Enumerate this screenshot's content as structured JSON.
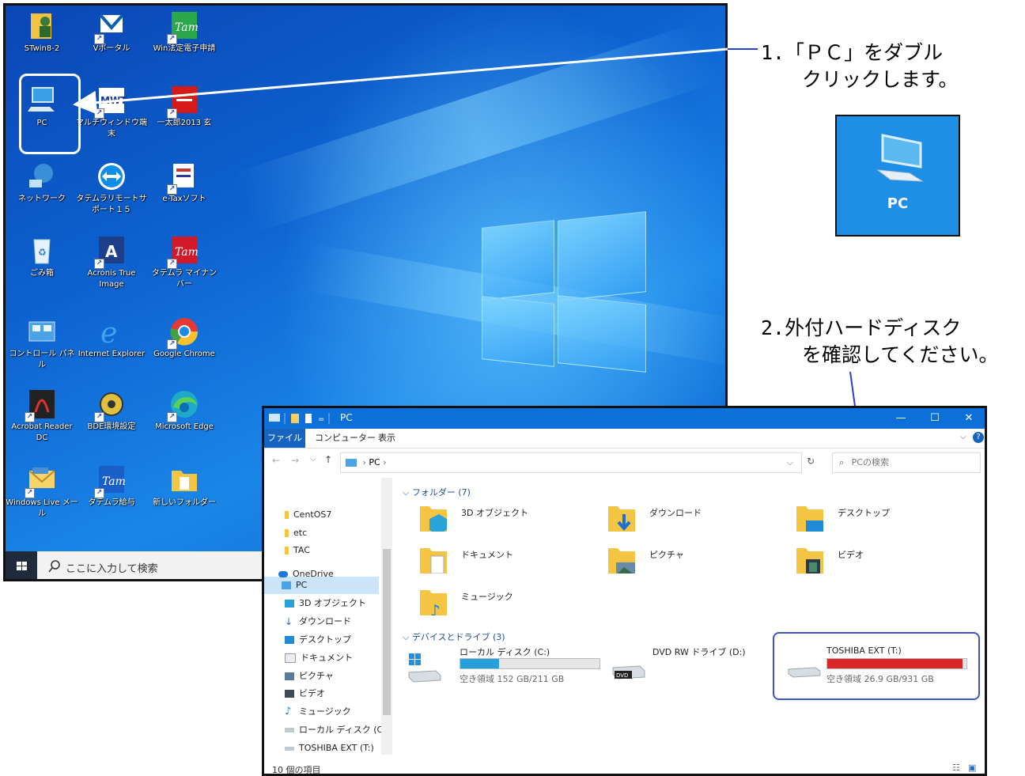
{
  "desktop": {
    "icons": [
      {
        "id": "stwin",
        "label": "STwin8-2"
      },
      {
        "id": "vportal",
        "label": "Vポータル"
      },
      {
        "id": "win-houtei",
        "label": "Win法定電子申請"
      },
      {
        "id": "pc",
        "label": "PC"
      },
      {
        "id": "multiwindow",
        "label": "マルチウィンドウ端末"
      },
      {
        "id": "ichitaro",
        "label": "一太郎2013 玄"
      },
      {
        "id": "network",
        "label": "ネットワーク"
      },
      {
        "id": "remote-support",
        "label": "タテムラリモートサポート１５"
      },
      {
        "id": "etax",
        "label": "e-Taxソフト"
      },
      {
        "id": "recycle",
        "label": "ごみ箱"
      },
      {
        "id": "acronis",
        "label": "Acronis True Image"
      },
      {
        "id": "tatemura-mynumber",
        "label": "タテムラ マイナンバー"
      },
      {
        "id": "control-panel",
        "label": "コントロール パネル"
      },
      {
        "id": "ie",
        "label": "Internet Explorer"
      },
      {
        "id": "chrome",
        "label": "Google Chrome"
      },
      {
        "id": "acrobat",
        "label": "Acrobat Reader DC"
      },
      {
        "id": "bde",
        "label": "BDE環境設定"
      },
      {
        "id": "edge",
        "label": "Microsoft Edge"
      },
      {
        "id": "wlm",
        "label": "Windows Live メール"
      },
      {
        "id": "tatemura-kyuyo",
        "label": "タテムラ給与"
      },
      {
        "id": "new-folder",
        "label": "新しいフォルダー"
      }
    ],
    "taskbar": {
      "search_placeholder": "ここに入力して検索"
    }
  },
  "annotations": {
    "step1_line1": "1.「ＰＣ」をダブル",
    "step1_line2": "クリックします。",
    "step2_line1": "2.外付ハードディスク",
    "step2_line2": "を確認してください。",
    "zoom_label": "PC"
  },
  "explorer": {
    "title": "PC",
    "ribbon_tabs": {
      "file": "ファイル",
      "computer": "コンピューター",
      "view": "表示"
    },
    "address": "PC",
    "search_placeholder": "PCの検索",
    "nav": {
      "centos": "CentOS7",
      "etc": "etc",
      "tac": "TAC",
      "onedrive": "OneDrive",
      "pc": "PC",
      "objects3d": "3D オブジェクト",
      "downloads": "ダウンロード",
      "desktop": "デスクトップ",
      "documents": "ドキュメント",
      "pictures": "ピクチャ",
      "videos": "ビデオ",
      "music": "ミュージック",
      "local_disk": "ローカル ディスク (C:)",
      "toshiba": "TOSHIBA EXT (T:)"
    },
    "folders_header": "フォルダー (7)",
    "folders": {
      "objects3d": "3D オブジェクト",
      "downloads": "ダウンロード",
      "desktop": "デスクトップ",
      "documents": "ドキュメント",
      "pictures": "ピクチャ",
      "videos": "ビデオ",
      "music": "ミュージック"
    },
    "devices_header": "デバイスとドライブ (3)",
    "drives": {
      "c": {
        "name": "ローカル ディスク (C:)",
        "free": "空き領域 152 GB/211 GB",
        "used_fraction": 0.28
      },
      "d": {
        "name": "DVD RW ドライブ (D:)"
      },
      "t": {
        "name": "TOSHIBA EXT (T:)",
        "free": "空き領域 26.9 GB/931 GB",
        "used_fraction": 0.97
      }
    },
    "status_items": "10 個の項目"
  },
  "colors": {
    "accent": "#0d6fd8",
    "drive_ok": "#26a0da",
    "drive_full": "#da2626",
    "highlight_box": "#3b55c7"
  }
}
